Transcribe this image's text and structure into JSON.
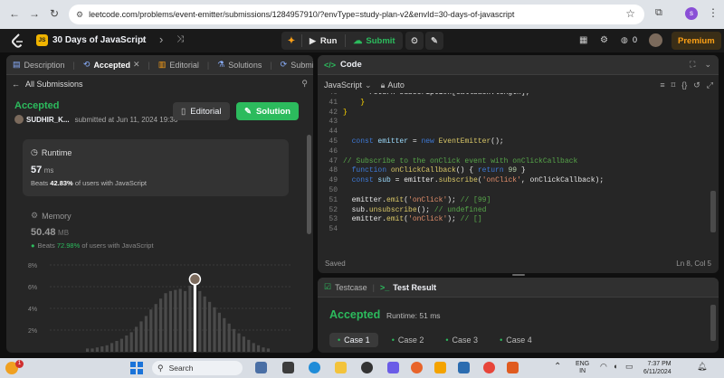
{
  "browser": {
    "url": "leetcode.com/problems/event-emitter/submissions/1284957910/?envType=study-plan-v2&envId=30-days-of-javascript",
    "profile_initial": "s"
  },
  "topbar": {
    "study_plan_title": "30 Days of JavaScript",
    "badge": "JS",
    "run_label": "Run",
    "submit_label": "Submit",
    "streak": "0",
    "premium_label": "Premium"
  },
  "left": {
    "tabs": [
      "Description",
      "Accepted",
      "Editorial",
      "Solutions",
      "Submissions"
    ],
    "all_submissions": "All Submissions",
    "status": "Accepted",
    "user": "SUDHIR_K...",
    "submitted_at": "submitted at Jun 11, 2024 19:36",
    "editorial_btn": "Editorial",
    "solution_btn": "Solution",
    "runtime": {
      "label": "Runtime",
      "value": "57",
      "unit": "ms",
      "beats_prefix": "Beats",
      "beats_pct": "42.83%",
      "beats_suffix": "of users with JavaScript"
    },
    "memory": {
      "label": "Memory",
      "value": "50.48",
      "unit": "MB",
      "beats_prefix": "Beats",
      "beats_pct": "72.98%",
      "beats_suffix": "of users with JavaScript"
    },
    "chart_data": {
      "type": "bar",
      "y_ticks": [
        "8%",
        "6%",
        "4%",
        "2%"
      ],
      "ylim": [
        0,
        8
      ],
      "values": [
        0.3,
        0.3,
        0.4,
        0.5,
        0.6,
        0.8,
        1.0,
        1.2,
        1.5,
        1.8,
        2.3,
        2.8,
        3.3,
        3.9,
        4.4,
        4.9,
        5.4,
        5.6,
        5.7,
        5.8,
        5.6,
        6.1,
        6.6,
        5.6,
        5.1,
        4.6,
        4.1,
        3.6,
        3.1,
        2.6,
        2.1,
        1.7,
        1.4,
        1.1,
        0.8,
        0.6,
        0.4,
        0.3
      ],
      "highlight_index": 22
    }
  },
  "editor": {
    "title": "Code",
    "language": "JavaScript",
    "auto_label": "Auto",
    "saved_label": "Saved",
    "cursor": "Ln 8, Col 5",
    "lines": [
      {
        "n": "40",
        "tokens": [
          {
            "t": "      return subscription[callback.length];",
            "c": "plain"
          }
        ]
      },
      {
        "n": "41",
        "tokens": [
          {
            "t": "    }",
            "c": "br"
          }
        ]
      },
      {
        "n": "42",
        "tokens": [
          {
            "t": "}",
            "c": "br"
          }
        ]
      },
      {
        "n": "43",
        "tokens": []
      },
      {
        "n": "44",
        "tokens": []
      },
      {
        "n": "45",
        "tokens": [
          {
            "t": "  ",
            "c": "plain"
          },
          {
            "t": "const",
            "c": "kw"
          },
          {
            "t": " emitter ",
            "c": "var"
          },
          {
            "t": "= ",
            "c": "plain"
          },
          {
            "t": "new",
            "c": "kw"
          },
          {
            "t": " EventEmitter",
            "c": "fn"
          },
          {
            "t": "();",
            "c": "plain"
          }
        ]
      },
      {
        "n": "46",
        "tokens": []
      },
      {
        "n": "47",
        "tokens": [
          {
            "t": "// Subscribe to the onClick event with onClickCallback",
            "c": "com"
          }
        ]
      },
      {
        "n": "48",
        "tokens": [
          {
            "t": "  ",
            "c": "plain"
          },
          {
            "t": "function",
            "c": "kw"
          },
          {
            "t": " onClickCallback",
            "c": "fn"
          },
          {
            "t": "() { ",
            "c": "plain"
          },
          {
            "t": "return",
            "c": "kw"
          },
          {
            "t": " 99",
            "c": "num"
          },
          {
            "t": " }",
            "c": "plain"
          }
        ]
      },
      {
        "n": "49",
        "tokens": [
          {
            "t": "  ",
            "c": "plain"
          },
          {
            "t": "const",
            "c": "kw"
          },
          {
            "t": " sub ",
            "c": "var"
          },
          {
            "t": "= emitter.",
            "c": "plain"
          },
          {
            "t": "subscribe",
            "c": "fn"
          },
          {
            "t": "(",
            "c": "plain"
          },
          {
            "t": "'onClick'",
            "c": "str"
          },
          {
            "t": ", onClickCallback);",
            "c": "plain"
          }
        ]
      },
      {
        "n": "50",
        "tokens": []
      },
      {
        "n": "51",
        "tokens": [
          {
            "t": "  emitter.",
            "c": "plain"
          },
          {
            "t": "emit",
            "c": "fn"
          },
          {
            "t": "(",
            "c": "plain"
          },
          {
            "t": "'onClick'",
            "c": "str"
          },
          {
            "t": "); ",
            "c": "plain"
          },
          {
            "t": "// [99]",
            "c": "com"
          }
        ]
      },
      {
        "n": "52",
        "tokens": [
          {
            "t": "  sub.",
            "c": "plain"
          },
          {
            "t": "unsubscribe",
            "c": "fn"
          },
          {
            "t": "(); ",
            "c": "plain"
          },
          {
            "t": "// undefined",
            "c": "com"
          }
        ]
      },
      {
        "n": "53",
        "tokens": [
          {
            "t": "  emitter.",
            "c": "plain"
          },
          {
            "t": "emit",
            "c": "fn"
          },
          {
            "t": "(",
            "c": "plain"
          },
          {
            "t": "'onClick'",
            "c": "str"
          },
          {
            "t": "); ",
            "c": "plain"
          },
          {
            "t": "// []",
            "c": "com"
          }
        ]
      },
      {
        "n": "54",
        "tokens": []
      }
    ]
  },
  "console": {
    "testcase_tab": "Testcase",
    "result_tab": "Test Result",
    "status": "Accepted",
    "runtime": "Runtime: 51 ms",
    "cases": [
      "Case 1",
      "Case 2",
      "Case 3",
      "Case 4"
    ]
  },
  "taskbar": {
    "notif_count": "1",
    "search_placeholder": "Search",
    "lang1": "ENG",
    "lang2": "IN",
    "time": "7:37 PM",
    "date": "6/11/2024"
  },
  "colors": {
    "green": "#2cbb5d",
    "accent": "#ffa116",
    "blue": "#3e79d6"
  }
}
